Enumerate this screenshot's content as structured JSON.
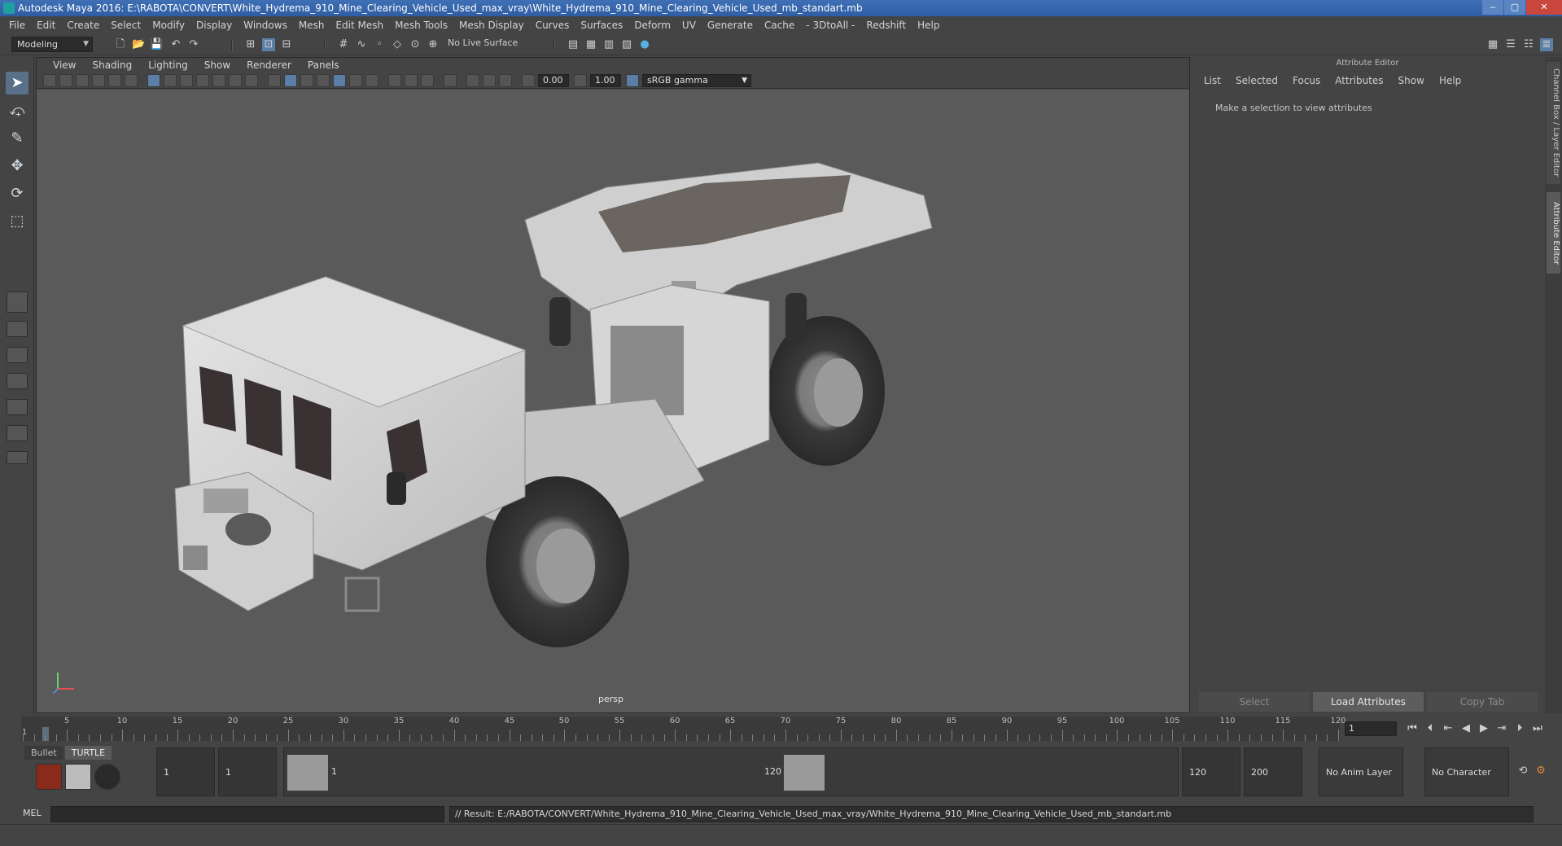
{
  "window": {
    "title": "Autodesk Maya 2016: E:\\RABOTA\\CONVERT\\White_Hydrema_910_Mine_Clearing_Vehicle_Used_max_vray\\White_Hydrema_910_Mine_Clearing_Vehicle_Used_mb_standart.mb",
    "minimize": "‒",
    "maximize": "▢",
    "close": "✕"
  },
  "menu": [
    "File",
    "Edit",
    "Create",
    "Select",
    "Modify",
    "Display",
    "Windows",
    "Mesh",
    "Edit Mesh",
    "Mesh Tools",
    "Mesh Display",
    "Curves",
    "Surfaces",
    "Deform",
    "UV",
    "Generate",
    "Cache",
    "- 3DtoAll -",
    "Redshift",
    "Help"
  ],
  "toolbar": {
    "mode": "Modeling",
    "live_surface": "No Live Surface"
  },
  "viewport": {
    "menu": [
      "View",
      "Shading",
      "Lighting",
      "Show",
      "Renderer",
      "Panels"
    ],
    "exposure": "0.00",
    "gamma": "1.00",
    "color_space": "sRGB gamma",
    "camera_label": "persp"
  },
  "attribute_editor": {
    "title": "Attribute Editor",
    "menu": [
      "List",
      "Selected",
      "Focus",
      "Attributes",
      "Show",
      "Help"
    ],
    "hint": "Make a selection to view attributes",
    "buttons": {
      "select": "Select",
      "load": "Load Attributes",
      "copy": "Copy Tab"
    }
  },
  "side_tabs": {
    "channel_box": "Channel Box / Layer Editor",
    "attribute_editor": "Attribute Editor"
  },
  "timeline": {
    "ticks": [
      "5",
      "10",
      "15",
      "20",
      "25",
      "30",
      "35",
      "40",
      "45",
      "50",
      "55",
      "60",
      "65",
      "70",
      "75",
      "80",
      "85",
      "90",
      "95",
      "100",
      "105",
      "110",
      "115",
      "120"
    ],
    "start_label": "1",
    "current_frame": "1"
  },
  "range": {
    "shelf_tabs": [
      "Bullet",
      "TURTLE"
    ],
    "start": "1",
    "playback_start": "1",
    "range_start_label": "1",
    "range_end_label": "120",
    "playback_end": "120",
    "end": "200",
    "anim_layer": "No Anim Layer",
    "character_set": "No Character Set"
  },
  "command": {
    "mode": "MEL",
    "result": "// Result: E:/RABOTA/CONVERT/White_Hydrema_910_Mine_Clearing_Vehicle_Used_max_vray/White_Hydrema_910_Mine_Clearing_Vehicle_Used_mb_standart.mb"
  },
  "colors": {
    "accent": "#5b7ea6",
    "viewport_bg": "#5a5a5a",
    "title_bg": "#2e5da3"
  }
}
